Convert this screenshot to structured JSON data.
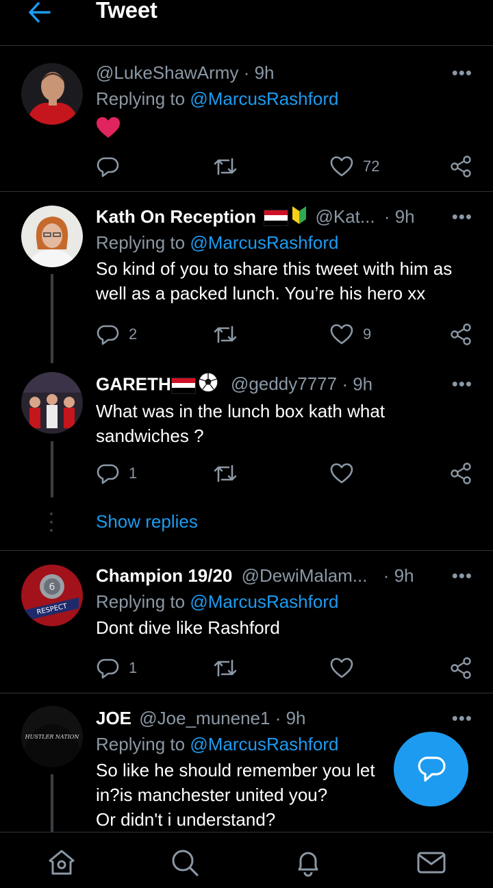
{
  "header": {
    "title": "Tweet",
    "back_icon": "arrow-left-icon"
  },
  "colors": {
    "accent": "#1d9bf0",
    "like": "#e0245e",
    "muted": "#8b98a5",
    "bg": "#000000"
  },
  "tweets": [
    {
      "name": "",
      "handle": "@LukeShawArmy",
      "time": "· 9h",
      "replying_prefix": "Replying to",
      "replying_to": "@MarcusRashford",
      "text": "",
      "emoji": "heart",
      "replies": "",
      "likes": "72"
    },
    {
      "name": "Kath On Reception",
      "handle": "@Kat...",
      "time": "· 9h",
      "replying_prefix": "Replying to",
      "replying_to": "@MarcusRashford",
      "text": "So kind of you to share this tweet with him as well as a packed lunch. You’re his hero xx",
      "replies": "2",
      "likes": "9"
    },
    {
      "name": "GARETH",
      "handle": "@geddy7777",
      "time": "· 9h",
      "text": "What was in the lunch box kath what sandwiches ?",
      "replies": "1",
      "likes": ""
    },
    {
      "name": "Champion 19/20",
      "handle": "@DewiMalam...",
      "time": "· 9h",
      "replying_prefix": "Replying to",
      "replying_to": "@MarcusRashford",
      "text": "Dont dive like Rashford",
      "replies": "1",
      "likes": ""
    },
    {
      "name": "JOE",
      "handle": "@Joe_munene1",
      "time": "· 9h",
      "replying_prefix": "Replying to",
      "replying_to": "@MarcusRashford",
      "text_lines": [
        "So like he should remember you let",
        "in?is manchester united you?",
        "Or didn't i understand?"
      ],
      "avatar_text": "HUSTLER NATION"
    }
  ],
  "show_replies": "Show replies",
  "more_label": "•••",
  "avatar_badge_text": "RESPECT",
  "bottom_nav": [
    "home-icon",
    "search-icon",
    "notifications-icon",
    "messages-icon"
  ]
}
